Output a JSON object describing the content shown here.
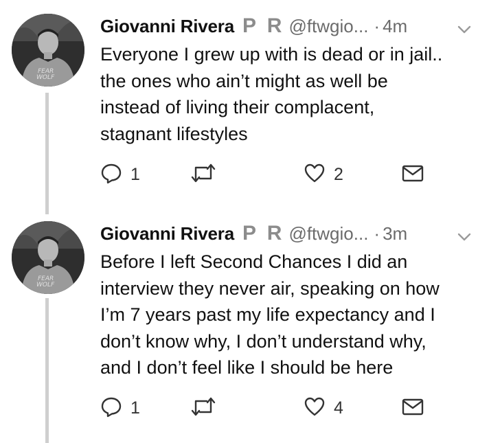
{
  "tweets": [
    {
      "author": "Giovanni Rivera",
      "badge": "P R",
      "handle": "@ftwgio...",
      "separator": "·",
      "time": "4m",
      "lines": [
        "Everyone I grew up with is dead or in jail..",
        "the ones who ain’t might as well be",
        "instead of living their complacent,",
        "stagnant lifestyles"
      ],
      "replies": "1",
      "retweets": "",
      "likes": "2"
    },
    {
      "author": "Giovanni Rivera",
      "badge": "P R",
      "handle": "@ftwgio...",
      "separator": "·",
      "time": "3m",
      "lines": [
        "Before I left Second Chances I did an",
        "interview they never air, speaking on how",
        "I’m 7 years past my life expectancy and I",
        "don’t know why, I don’t understand why,",
        "and I don’t feel like I should be here"
      ],
      "replies": "1",
      "retweets": "",
      "likes": "4"
    }
  ],
  "icons": {
    "reply": "reply-icon",
    "retweet": "retweet-icon",
    "like": "heart-icon",
    "dm": "envelope-icon",
    "menu": "chevron-down-icon"
  },
  "colors": {
    "text": "#111111",
    "secondary": "#6b6b6b",
    "badge": "#8c8c8c",
    "thread_line": "#cfcfcf"
  }
}
